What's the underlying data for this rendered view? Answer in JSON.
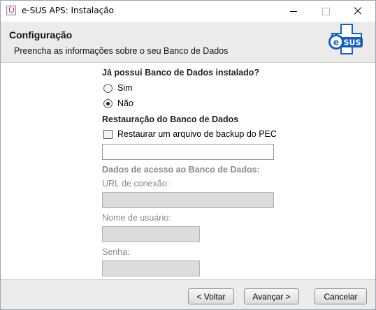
{
  "window": {
    "title": "e-SUS APS: Instalação"
  },
  "header": {
    "title": "Configuração",
    "subtitle": "Preencha as informações sobre o seu Banco de Dados",
    "logo_text": "SUS"
  },
  "database_installed": {
    "question": "Já possui Banco de Dados instalado?",
    "options": [
      {
        "label": "Sim",
        "selected": false
      },
      {
        "label": "Não",
        "selected": true
      }
    ]
  },
  "restore": {
    "section_title": "Restauração do Banco de Dados",
    "checkbox_label": "Restaurar um arquivo de backup do PEC",
    "checked": false,
    "file_path_value": ""
  },
  "access": {
    "section_title": "Dados de acesso ao Banco de Dados:",
    "url_label": "URL de conexão:",
    "url_value": "",
    "username_label": "Nome de usuário:",
    "username_value": "",
    "password_label": "Senha:",
    "password_value": ""
  },
  "footer": {
    "back_label": "< Voltar",
    "next_label": "Avançar >",
    "cancel_label": "Cancelar"
  },
  "colors": {
    "logo_blue": "#1a5fb4",
    "header_bg": "#ebebeb",
    "disabled_field": "#dcdcdc"
  }
}
